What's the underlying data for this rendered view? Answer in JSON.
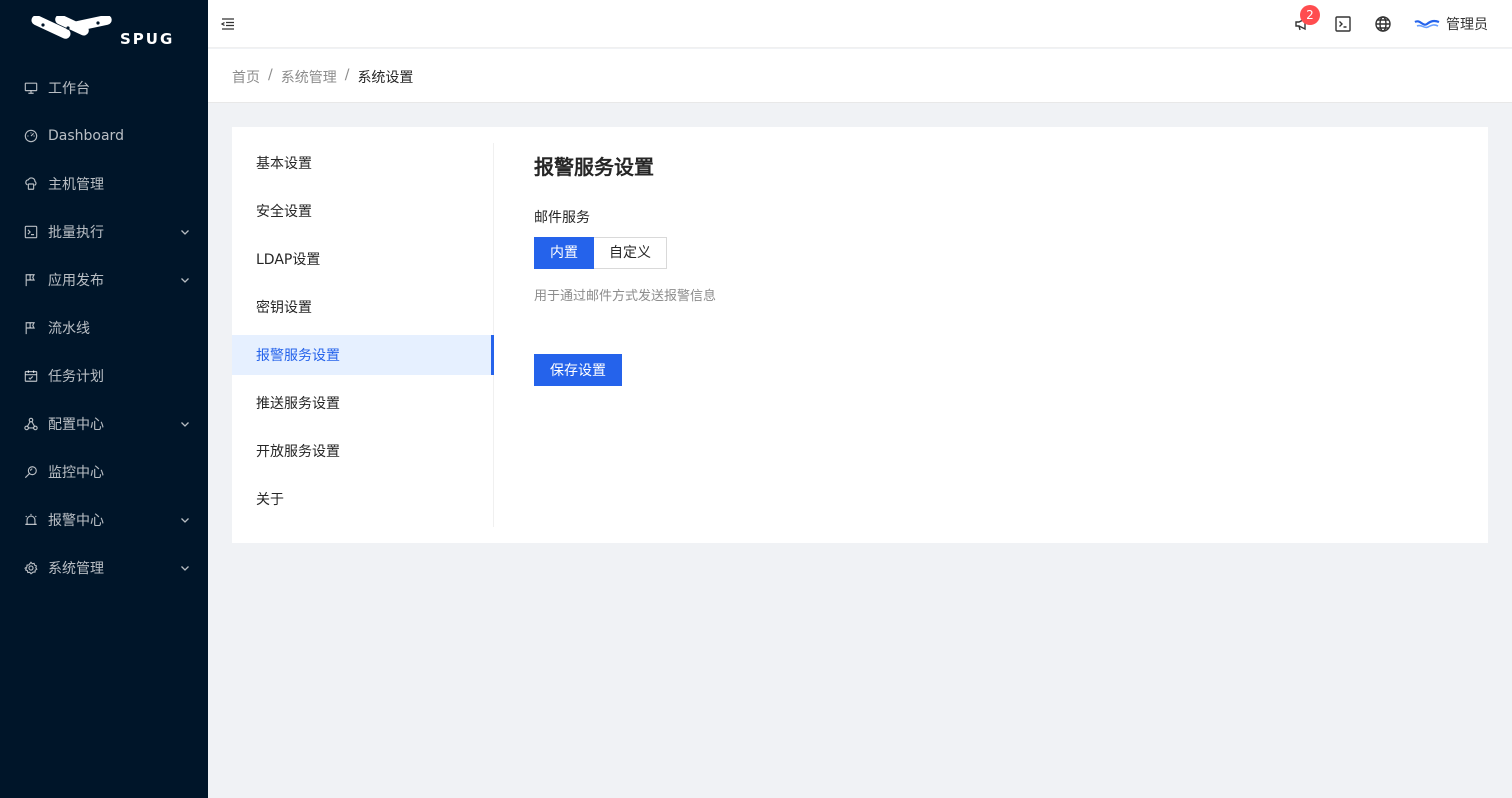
{
  "app": {
    "logo_text": "SPUG"
  },
  "sidebar": {
    "items": [
      {
        "label": "工作台",
        "icon": "desktop-icon",
        "has_children": false
      },
      {
        "label": "Dashboard",
        "icon": "dashboard-icon",
        "has_children": false
      },
      {
        "label": "主机管理",
        "icon": "cloud-server-icon",
        "has_children": false
      },
      {
        "label": "批量执行",
        "icon": "terminal-icon",
        "has_children": true
      },
      {
        "label": "应用发布",
        "icon": "flag-icon",
        "has_children": true
      },
      {
        "label": "流水线",
        "icon": "flag-icon",
        "has_children": false
      },
      {
        "label": "任务计划",
        "icon": "schedule-icon",
        "has_children": false
      },
      {
        "label": "配置中心",
        "icon": "deployment-icon",
        "has_children": true
      },
      {
        "label": "监控中心",
        "icon": "monitor-icon",
        "has_children": false
      },
      {
        "label": "报警中心",
        "icon": "alert-icon",
        "has_children": true
      },
      {
        "label": "系统管理",
        "icon": "setting-icon",
        "has_children": true
      }
    ]
  },
  "header": {
    "notification_count": "2",
    "user_name": "管理员",
    "icons": [
      "menu-fold-icon",
      "notification-icon",
      "terminal-icon",
      "global-icon"
    ]
  },
  "breadcrumb": [
    "首页",
    "系统管理",
    "系统设置"
  ],
  "settings_nav": {
    "items": [
      "基本设置",
      "安全设置",
      "LDAP设置",
      "密钥设置",
      "报警服务设置",
      "推送服务设置",
      "开放服务设置",
      "关于"
    ],
    "active_index": 4
  },
  "content": {
    "title": "报警服务设置",
    "mail_label": "邮件服务",
    "options": [
      "内置",
      "自定义"
    ],
    "selected_option": "内置",
    "help_text": "用于通过邮件方式发送报警信息",
    "save_label": "保存设置"
  },
  "colors": {
    "sidebar_bg": "#001529",
    "primary": "#2563eb",
    "badge": "#ff4d4f",
    "page_bg": "#f0f2f5"
  }
}
